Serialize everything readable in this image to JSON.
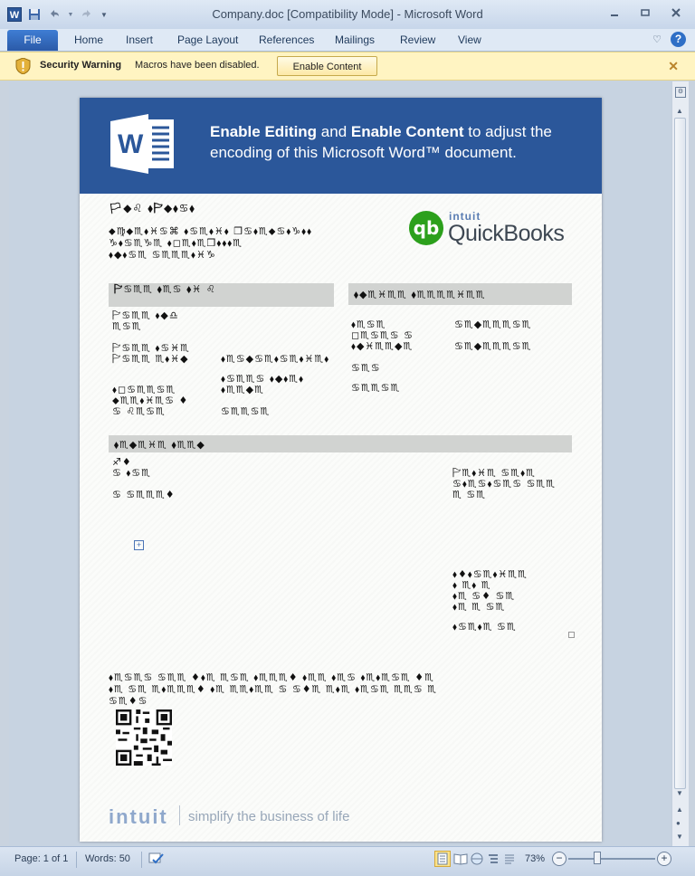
{
  "window": {
    "title": "Company.doc [Compatibility Mode] - Microsoft Word",
    "minimize_icon": "minimize-icon",
    "maximize_icon": "restore-icon",
    "close_icon": "close-icon"
  },
  "quick_access": {
    "app_icon_letter": "W",
    "undo_icon": "undo-icon",
    "redo_icon": "redo-icon",
    "save_icon": "save-icon"
  },
  "ribbon": {
    "file_label": "File",
    "tabs": [
      "Home",
      "Insert",
      "Page Layout",
      "References",
      "Mailings",
      "Review",
      "View"
    ]
  },
  "security_bar": {
    "title": "Security Warning",
    "message": "Macros have been disabled.",
    "button_label": "Enable Content"
  },
  "document": {
    "banner": {
      "bold1": "Enable Editing",
      "and": " and ",
      "bold2": "Enable Content",
      "rest": " to adjust the encoding of this Microsoft Word™ document."
    },
    "sender_title": "🏳︎◆♌︎ ⬧︎🏱︎◆⬧︎♋︎⬧︎",
    "sender_lines": [
      "⬥︎♍︎⬥︎♏︎⬧︎♓︎♋︎⌘︎ ⬧︎♋︎♏︎⬧︎♓︎⬧︎ ❒︎♋︎⬧︎♏︎⬥︎♋︎⬧︎♑︎⬧︎⬧︎",
      "♑︎⬧︎♋︎♏︎♑︎♏︎ ⬧︎◻︎♏︎⬧︎♏︎❒︎⬧︎⬧︎⬧︎♏︎",
      "⬧︎◆︎⬧︎♋︎♏︎ ♋︎♏︎♏︎♏︎⬧︎♓︎♑︎"
    ],
    "quickbooks_brand": "intuit",
    "quickbooks_name": "QuickBooks",
    "quickbooks_mark": "qb",
    "section1_header": "🏱︎♋︎♏︎♏︎ ⬧︎♏︎♋︎ ⬧︎♓︎ ♌︎",
    "section1_fields": [
      "🏱︎♋︎♏︎♏︎ ⬧︎◆︎♎︎",
      "♏︎♋︎♏︎",
      "🏱︎♋︎♏︎♏︎ ⬧︎♋︎♓︎♏︎",
      "🏱︎♋︎♏︎♏︎ ♏︎⬧︎♓︎◆︎",
      "⬧︎◻︎♋︎♏︎♏︎♋︎♏︎",
      "⬥︎♏︎♏︎⬧︎♓︎♏︎♋︎ ♦︎",
      "♋︎ ♌︎♏︎♋︎♏︎"
    ],
    "section1_values": [
      "⬧︎♏︎♋︎◆︎♋︎♏︎⬧︎♋︎♏︎⬧︎♓︎♏︎⬧︎",
      "⬧︎♋︎♏︎♏︎♋︎ ⬧︎◆︎⬧︎♏︎⬧︎",
      "⬧︎♏︎♏︎◆︎♏︎",
      "♋︎♏︎♏︎♋︎♏︎"
    ],
    "section2_header": "⬧︎◆︎♏︎♓︎♏︎♏︎ ⬧︎♏︎♏︎♏︎♏︎♓︎♏︎♏︎",
    "section2_fields": [
      "⬧︎♏︎♋︎♏︎",
      "◻︎♏︎♋︎♏︎♋︎ ♋︎",
      "⬧︎◆︎♓︎♏︎♏︎◆︎♏︎",
      "♋︎♏︎♋︎",
      "♋︎♏︎♏︎♋︎♏︎"
    ],
    "section2_values": [
      "♋︎♏︎◆︎♏︎♏︎♏︎♋︎♏︎",
      "♋︎♏︎◆︎♏︎♏︎♏︎♋︎♏︎"
    ],
    "section3_header": "⬧︎♏︎◆︎♏︎♓︎♏︎ ⬧︎♏︎♏︎◆︎",
    "section3_left": [
      "♐︎♦︎",
      "♋︎ ⬧︎♋︎♏︎",
      "♋︎ ♋︎♏︎♏︎♏︎♦︎"
    ],
    "section3_right_header": "🏱︎♏︎⬧︎♓︎♏︎ ♋︎♏︎⬧︎♏︎",
    "section3_right_rows": [
      "♋︎⬧︎♏︎♋︎⬧︎♋︎♏︎♋︎ ♋︎♏︎♏︎",
      "♏︎ ♋︎♏︎"
    ],
    "totals": [
      "⬧︎♦︎⬧︎♋︎♏︎⬧︎♓︎♏︎♏︎",
      "⬧︎ ♏︎⬧︎ ♏︎",
      "⬧︎♏︎ ♋︎♦︎ ♋︎♏︎",
      "⬧︎♏︎ ♏︎ ♋︎♏︎",
      "⬧︎♋︎♏︎⬧︎♏︎ ♋︎♏︎"
    ],
    "notes": [
      "⬧︎♏︎♋︎♏︎♋︎ ♋︎♏︎♏︎ ♦︎⬧︎♏︎ ♏︎♋︎♏︎ ⬧︎♏︎♏︎♏︎♦︎ ⬧︎♏︎♏︎ ⬧︎♏︎♋︎ ⬧︎♏︎⬧︎♏︎♋︎♏︎ ♦︎♏︎",
      "⬧︎♏︎ ♋︎♏︎ ♏︎⬧︎♏︎♏︎♏︎♦︎ ⬧︎♏︎ ♏︎♏︎⬧︎♏︎♏︎ ♋︎ ♋︎♦︎♏︎ ♏︎⬧︎♏︎ ⬧︎♏︎♋︎♏︎ ♏︎♏︎♋︎ ♏︎",
      "♋︎♏︎♦︎♋︎"
    ],
    "footer_brand": "intuit",
    "footer_tagline": "simplify the business of life"
  },
  "status": {
    "page": "Page: 1 of 1",
    "words": "Words: 50",
    "zoom": "73%",
    "proofing_icon": "proofing-check-icon"
  }
}
